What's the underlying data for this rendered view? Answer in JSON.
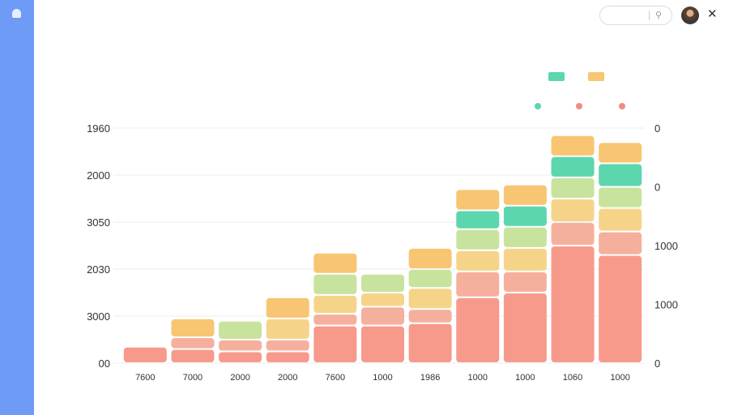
{
  "app": {
    "title": ""
  },
  "sidebar": {
    "items": [
      {
        "label": ""
      },
      {
        "label": ""
      },
      {
        "label": ""
      },
      {
        "label": ""
      },
      {
        "label": ""
      },
      {
        "label": ""
      }
    ]
  },
  "header": {
    "badge": ""
  },
  "panel": {
    "title": "",
    "subtitle": ""
  },
  "icons": {
    "search": "search-icon",
    "close": "close-icon",
    "bell": "bell-icon",
    "avatar": "user-avatar"
  },
  "chart_data": {
    "type": "bar",
    "title": "",
    "stacked": true,
    "categories": [
      "7600",
      "7000",
      "2000",
      "2000",
      "7600",
      "1000",
      "1986",
      "1000",
      "1000",
      "1060",
      "1000"
    ],
    "y_tick_labels_left": [
      "1960",
      "2000",
      "3050",
      "2030",
      "3000",
      "00"
    ],
    "y_tick_labels_right": [
      "0",
      "0",
      "1000",
      "1000",
      "0"
    ],
    "y_range": [
      0,
      1
    ],
    "grid": true,
    "legend_position": "top-right",
    "legend": [
      {
        "name": "",
        "color": "#5cd6ad"
      },
      {
        "name": "",
        "color": "#f8c572"
      },
      {
        "name": "",
        "color": "#f08c80"
      },
      {
        "name": "",
        "color": "#f3a99a"
      },
      {
        "name": "",
        "color": "#f8d38a"
      }
    ],
    "segment_colors_bottom_to_top": [
      "#f79a8c",
      "#f5b09d",
      "#f5d48a",
      "#c8e39e",
      "#5cd6ad",
      "#f8c572"
    ],
    "series": [
      {
        "values": [
          0.07,
          0.06,
          0.05,
          0.05,
          0.16,
          0.16,
          0.17,
          0.28,
          0.3,
          0.5,
          0.46
        ]
      },
      {
        "values": [
          0.0,
          0.05,
          0.05,
          0.05,
          0.05,
          0.08,
          0.06,
          0.11,
          0.09,
          0.1,
          0.1
        ]
      },
      {
        "values": [
          0.0,
          0.0,
          0.0,
          0.09,
          0.08,
          0.06,
          0.09,
          0.09,
          0.1,
          0.1,
          0.1
        ]
      },
      {
        "values": [
          0.0,
          0.0,
          0.08,
          0.0,
          0.09,
          0.08,
          0.08,
          0.09,
          0.09,
          0.09,
          0.09
        ]
      },
      {
        "values": [
          0.0,
          0.0,
          0.0,
          0.0,
          0.0,
          0.0,
          0.0,
          0.08,
          0.09,
          0.09,
          0.1
        ]
      },
      {
        "values": [
          0.0,
          0.08,
          0.0,
          0.09,
          0.09,
          0.0,
          0.09,
          0.09,
          0.09,
          0.09,
          0.09
        ]
      }
    ]
  }
}
